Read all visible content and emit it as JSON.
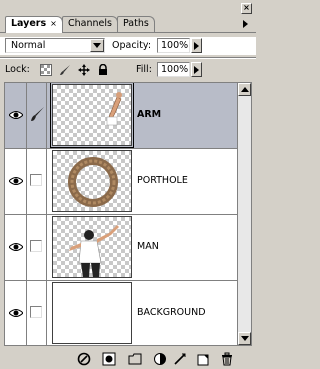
{
  "tabs": [
    {
      "label": "Layers",
      "active": true,
      "close": "×"
    },
    {
      "label": "Channels",
      "active": false
    },
    {
      "label": "Paths",
      "active": false
    }
  ],
  "window": {
    "close_glyph": "×"
  },
  "blend_mode": {
    "value": "Normal"
  },
  "opacity": {
    "label": "Opacity:",
    "value": "100%"
  },
  "lock": {
    "label": "Lock:"
  },
  "fill": {
    "label": "Fill:",
    "value": "100%"
  },
  "layers": [
    {
      "name": "ARM",
      "selected": true,
      "visible": true,
      "icon": "paintbrush-icon",
      "thumbnail": "arm"
    },
    {
      "name": "PORTHOLE",
      "selected": false,
      "visible": true,
      "icon": "",
      "thumbnail": "porthole"
    },
    {
      "name": "MAN",
      "selected": false,
      "visible": true,
      "icon": "",
      "thumbnail": "man"
    },
    {
      "name": "BACKGROUND",
      "selected": false,
      "visible": true,
      "icon": "",
      "thumbnail": "background"
    }
  ],
  "colors": {
    "panel": "#d4d0c8",
    "selected_row": "#b8bcc8",
    "list_bg": "#ffffff"
  },
  "bottom_tools": [
    "link-layers-icon",
    "layer-style-icon",
    "layer-mask-icon",
    "new-group-icon",
    "adjustment-layer-icon",
    "new-layer-icon",
    "delete-layer-icon"
  ]
}
